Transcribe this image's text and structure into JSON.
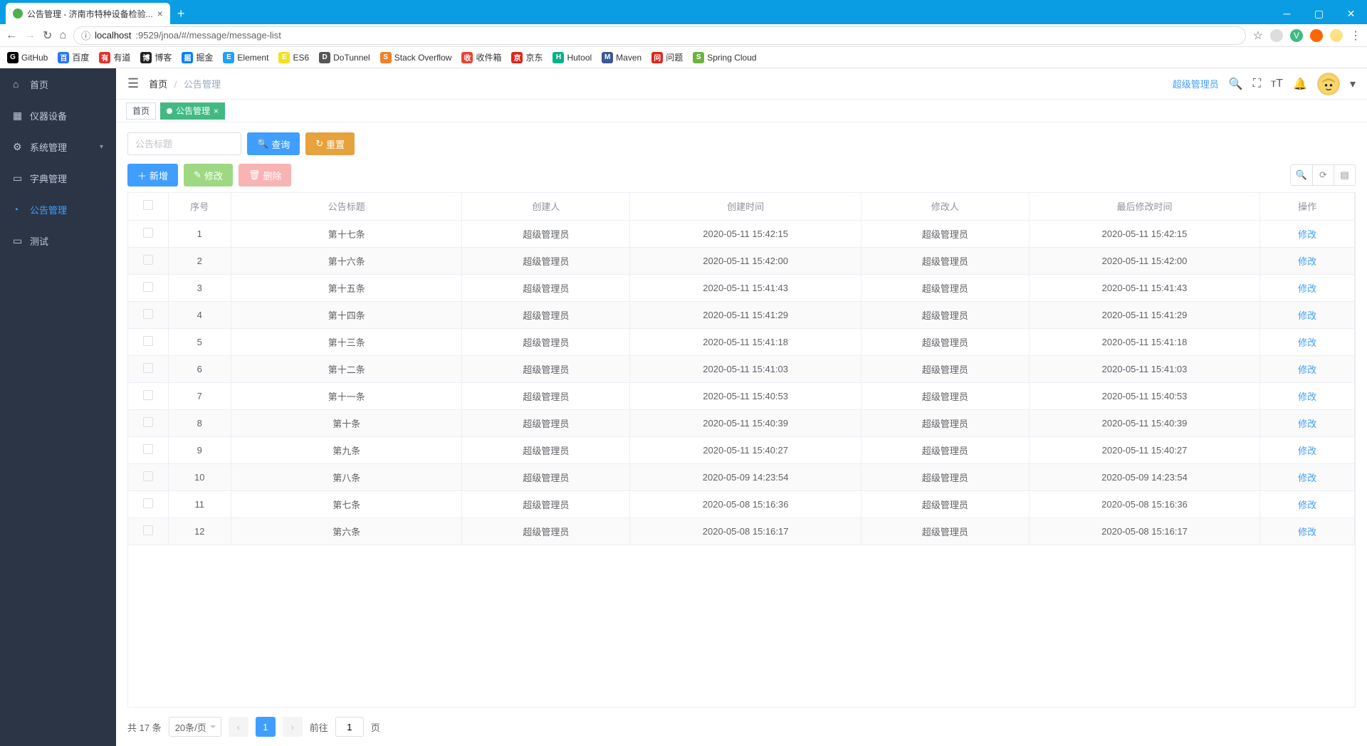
{
  "browser": {
    "tab_title": "公告管理 - 济南市特种设备检验...",
    "url_host": "localhost",
    "url_rest": ":9529/jnoa/#/message/message-list"
  },
  "bookmarks": [
    {
      "label": "GitHub",
      "bg": "#000"
    },
    {
      "label": "百度",
      "bg": "#2a73ff"
    },
    {
      "label": "有道",
      "bg": "#e6302a"
    },
    {
      "label": "博客",
      "bg": "#222"
    },
    {
      "label": "掘金",
      "bg": "#007fff"
    },
    {
      "label": "Element",
      "bg": "#20a0ff"
    },
    {
      "label": "ES6",
      "bg": "#f7df1e"
    },
    {
      "label": "DoTunnel",
      "bg": "#555"
    },
    {
      "label": "Stack Overflow",
      "bg": "#f48024"
    },
    {
      "label": "收件箱",
      "bg": "#ea4335"
    },
    {
      "label": "京东",
      "bg": "#e1251b"
    },
    {
      "label": "Hutool",
      "bg": "#00b38a"
    },
    {
      "label": "Maven",
      "bg": "#3b5998"
    },
    {
      "label": "问题",
      "bg": "#e1251b"
    },
    {
      "label": "Spring Cloud",
      "bg": "#6db33f"
    }
  ],
  "sidebar": [
    {
      "icon": "⌂",
      "label": "首页"
    },
    {
      "icon": "▦",
      "label": "仪器设备"
    },
    {
      "icon": "⚙",
      "label": "系统管理",
      "arrow": true
    },
    {
      "icon": "▭",
      "label": "字典管理"
    },
    {
      "icon": "◔",
      "label": "公告管理",
      "active": true
    },
    {
      "icon": "▭",
      "label": "测试"
    }
  ],
  "breadcrumb": {
    "home": "首页",
    "current": "公告管理"
  },
  "topbar": {
    "user": "超级管理员"
  },
  "tags": {
    "home": "首页",
    "active": "公告管理"
  },
  "filter": {
    "placeholder": "公告标题",
    "search": "查询",
    "reset": "重置"
  },
  "actions": {
    "add": "新增",
    "edit": "修改",
    "del": "删除"
  },
  "columns": {
    "idx": "序号",
    "title": "公告标题",
    "creator": "创建人",
    "ctime": "创建时间",
    "modifier": "修改人",
    "mtime": "最后修改时间",
    "op": "操作"
  },
  "op_label": "修改",
  "rows": [
    {
      "idx": 1,
      "title": "第十七条",
      "creator": "超级管理员",
      "ctime": "2020-05-11 15:42:15",
      "modifier": "超级管理员",
      "mtime": "2020-05-11 15:42:15"
    },
    {
      "idx": 2,
      "title": "第十六条",
      "creator": "超级管理员",
      "ctime": "2020-05-11 15:42:00",
      "modifier": "超级管理员",
      "mtime": "2020-05-11 15:42:00"
    },
    {
      "idx": 3,
      "title": "第十五条",
      "creator": "超级管理员",
      "ctime": "2020-05-11 15:41:43",
      "modifier": "超级管理员",
      "mtime": "2020-05-11 15:41:43"
    },
    {
      "idx": 4,
      "title": "第十四条",
      "creator": "超级管理员",
      "ctime": "2020-05-11 15:41:29",
      "modifier": "超级管理员",
      "mtime": "2020-05-11 15:41:29"
    },
    {
      "idx": 5,
      "title": "第十三条",
      "creator": "超级管理员",
      "ctime": "2020-05-11 15:41:18",
      "modifier": "超级管理员",
      "mtime": "2020-05-11 15:41:18"
    },
    {
      "idx": 6,
      "title": "第十二条",
      "creator": "超级管理员",
      "ctime": "2020-05-11 15:41:03",
      "modifier": "超级管理员",
      "mtime": "2020-05-11 15:41:03"
    },
    {
      "idx": 7,
      "title": "第十一条",
      "creator": "超级管理员",
      "ctime": "2020-05-11 15:40:53",
      "modifier": "超级管理员",
      "mtime": "2020-05-11 15:40:53"
    },
    {
      "idx": 8,
      "title": "第十条",
      "creator": "超级管理员",
      "ctime": "2020-05-11 15:40:39",
      "modifier": "超级管理员",
      "mtime": "2020-05-11 15:40:39"
    },
    {
      "idx": 9,
      "title": "第九条",
      "creator": "超级管理员",
      "ctime": "2020-05-11 15:40:27",
      "modifier": "超级管理员",
      "mtime": "2020-05-11 15:40:27"
    },
    {
      "idx": 10,
      "title": "第八条",
      "creator": "超级管理员",
      "ctime": "2020-05-09 14:23:54",
      "modifier": "超级管理员",
      "mtime": "2020-05-09 14:23:54"
    },
    {
      "idx": 11,
      "title": "第七条",
      "creator": "超级管理员",
      "ctime": "2020-05-08 15:16:36",
      "modifier": "超级管理员",
      "mtime": "2020-05-08 15:16:36"
    },
    {
      "idx": 12,
      "title": "第六条",
      "creator": "超级管理员",
      "ctime": "2020-05-08 15:16:17",
      "modifier": "超级管理员",
      "mtime": "2020-05-08 15:16:17"
    }
  ],
  "pager": {
    "total": "共 17 条",
    "page_size": "20条/页",
    "current": "1",
    "goto_pre": "前往",
    "goto_suf": "页",
    "goto_val": "1"
  }
}
